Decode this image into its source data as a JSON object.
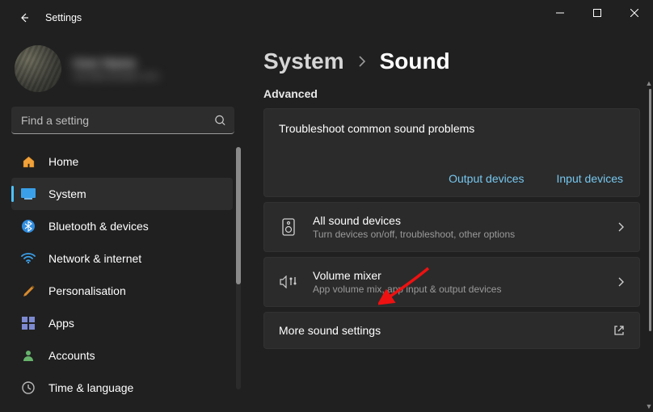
{
  "window": {
    "title": "Settings"
  },
  "profile": {
    "name": "User Name",
    "email": "user@example.com"
  },
  "search": {
    "placeholder": "Find a setting"
  },
  "sidebar": {
    "items": [
      {
        "label": "Home"
      },
      {
        "label": "System"
      },
      {
        "label": "Bluetooth & devices"
      },
      {
        "label": "Network & internet"
      },
      {
        "label": "Personalisation"
      },
      {
        "label": "Apps"
      },
      {
        "label": "Accounts"
      },
      {
        "label": "Time & language"
      }
    ],
    "selected_index": 1
  },
  "breadcrumb": {
    "parent": "System",
    "current": "Sound"
  },
  "section": {
    "heading": "Advanced",
    "troubleshoot": {
      "title": "Troubleshoot common sound problems",
      "output_link": "Output devices",
      "input_link": "Input devices"
    },
    "rows": [
      {
        "title": "All sound devices",
        "sub": "Turn devices on/off, troubleshoot, other options",
        "icon": "speaker",
        "action": "chevron"
      },
      {
        "title": "Volume mixer",
        "sub": "App volume mix, app input & output devices",
        "icon": "mixer",
        "action": "chevron"
      },
      {
        "title": "More sound settings",
        "sub": "",
        "icon": "",
        "action": "external"
      }
    ]
  }
}
